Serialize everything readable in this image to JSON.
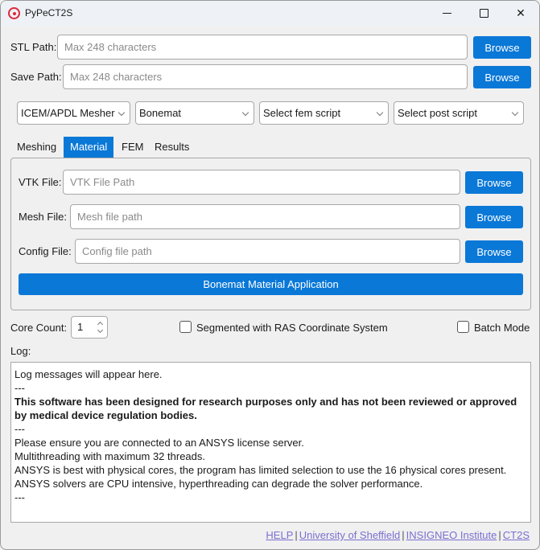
{
  "window": {
    "title": "PyPeCT2S",
    "icon": "target-icon",
    "controls": {
      "minimize": "minimize-icon",
      "maximize": "maximize-icon",
      "close": "✕"
    }
  },
  "paths": {
    "stl": {
      "label": "STL Path:",
      "value": "",
      "placeholder": "Max 248 characters",
      "button": "Browse"
    },
    "save": {
      "label": "Save Path:",
      "value": "",
      "placeholder": "Max 248 characters",
      "button": "Browse"
    }
  },
  "dropdowns": [
    {
      "selected": "ICEM/APDL Mesher"
    },
    {
      "selected": "Bonemat"
    },
    {
      "selected": "Select fem script"
    },
    {
      "selected": "Select post script"
    }
  ],
  "tabs": [
    {
      "label": "Meshing",
      "active": false
    },
    {
      "label": "Material",
      "active": true
    },
    {
      "label": "FEM",
      "active": false
    },
    {
      "label": "Results",
      "active": false
    }
  ],
  "material": {
    "vtk": {
      "label": "VTK File:",
      "value": "",
      "placeholder": "VTK File Path",
      "button": "Browse"
    },
    "mesh": {
      "label": "Mesh File:",
      "value": "",
      "placeholder": "Mesh file path",
      "button": "Browse"
    },
    "config": {
      "label": "Config File:",
      "value": "",
      "placeholder": "Config file path",
      "button": "Browse"
    },
    "apply_button": "Bonemat Material Application"
  },
  "options": {
    "core_count_label": "Core Count:",
    "core_count": "1",
    "segmented_label": "Segmented with RAS Coordinate System",
    "segmented_checked": false,
    "batch_label": "Batch Mode",
    "batch_checked": false
  },
  "log": {
    "label": "Log:",
    "lines": [
      {
        "text": "Log messages will appear here.",
        "bold": false
      },
      {
        "text": "---",
        "bold": false
      },
      {
        "text": "This software has been designed for research purposes only and has not been reviewed or approved by medical device regulation bodies.",
        "bold": true
      },
      {
        "text": "---",
        "bold": false
      },
      {
        "text": "Please ensure you are connected to an ANSYS license server.",
        "bold": false
      },
      {
        "text": "Multithreading with maximum 32 threads.",
        "bold": false
      },
      {
        "text": "ANSYS is best with physical cores, the program has limited selection to use the 16 physical cores present.",
        "bold": false
      },
      {
        "text": "ANSYS solvers are CPU intensive, hyperthreading can degrade the solver performance.",
        "bold": false
      },
      {
        "text": "---",
        "bold": false
      }
    ]
  },
  "footer": {
    "links": [
      "HELP",
      "University of Sheffield",
      "INSIGNEO Institute",
      "CT2S"
    ],
    "separator": "|",
    "link_color": "#7a6fd0"
  },
  "colors": {
    "accent": "#0a78d7",
    "app_icon": "#e0283c",
    "background": "#f0f0f0",
    "titlebar": "#eef2f6"
  }
}
